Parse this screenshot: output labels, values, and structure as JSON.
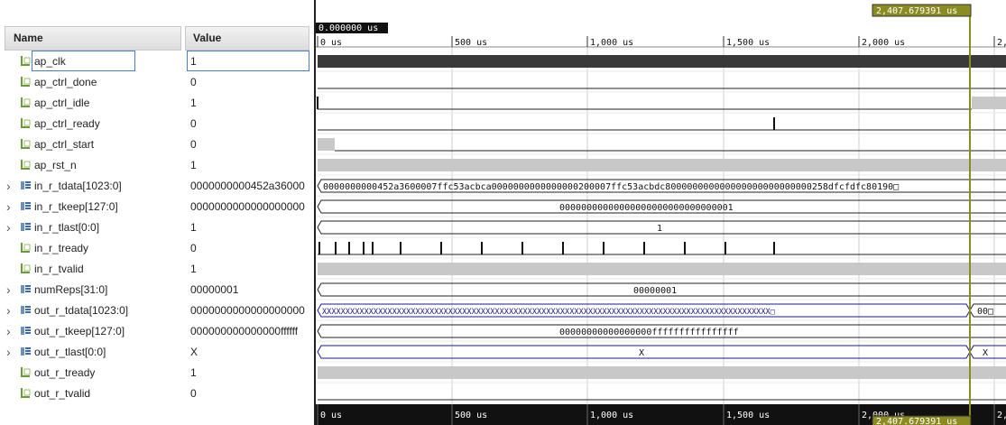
{
  "headers": {
    "name": "Name",
    "value": "Value"
  },
  "cursor": {
    "time_label": "2,407.679391 us",
    "origin_label": "0.000000 us"
  },
  "time_ruler": {
    "ticks": [
      "0 us",
      "500 us",
      "1,000 us",
      "1,500 us",
      "2,000 us",
      "2,"
    ]
  },
  "colors": {
    "wave_fill": "#c8c8c8",
    "bus_line": "#1a1a8c",
    "cursor": "#8b8b22",
    "cursor_label_bg": "#8b8b22"
  },
  "signals": [
    {
      "name": "ap_clk",
      "value": "1",
      "kind": "bit",
      "expandable": false
    },
    {
      "name": "ap_ctrl_done",
      "value": "0",
      "kind": "bit",
      "expandable": false
    },
    {
      "name": "ap_ctrl_idle",
      "value": "1",
      "kind": "bit",
      "expandable": false
    },
    {
      "name": "ap_ctrl_ready",
      "value": "0",
      "kind": "bit",
      "expandable": false
    },
    {
      "name": "ap_ctrl_start",
      "value": "0",
      "kind": "bit",
      "expandable": false
    },
    {
      "name": "ap_rst_n",
      "value": "1",
      "kind": "bit",
      "expandable": false
    },
    {
      "name": "in_r_tdata[1023:0]",
      "value": "0000000000452a36000",
      "kind": "bus",
      "expandable": true
    },
    {
      "name": "in_r_tkeep[127:0]",
      "value": "0000000000000000000",
      "kind": "bus",
      "expandable": true
    },
    {
      "name": "in_r_tlast[0:0]",
      "value": "1",
      "kind": "bus",
      "expandable": true
    },
    {
      "name": "in_r_tready",
      "value": "0",
      "kind": "bit",
      "expandable": false
    },
    {
      "name": "in_r_tvalid",
      "value": "1",
      "kind": "bit",
      "expandable": false
    },
    {
      "name": "numReps[31:0]",
      "value": "00000001",
      "kind": "bus",
      "expandable": true
    },
    {
      "name": "out_r_tdata[1023:0]",
      "value": "0000000000000000000",
      "kind": "bus",
      "expandable": true
    },
    {
      "name": "out_r_tkeep[127:0]",
      "value": "000000000000000ffffff",
      "kind": "bus",
      "expandable": true
    },
    {
      "name": "out_r_tlast[0:0]",
      "value": "X",
      "kind": "bus",
      "expandable": true
    },
    {
      "name": "out_r_tready",
      "value": "1",
      "kind": "bit",
      "expandable": false
    },
    {
      "name": "out_r_tvalid",
      "value": "0",
      "kind": "bit",
      "expandable": false
    }
  ],
  "bus_labels": {
    "in_r_tdata": "0000000000452a3600007ffc53acbca0000000000000000200007ffc53acbdc800000000000000000000000000258dfcfdfc80190□",
    "in_r_tkeep": "00000000000000000000000000000001",
    "in_r_tlast": "1",
    "numReps": "00000001",
    "out_r_tdata_a": "XXXXXXXXXXXXXXXXXXXXXXXXXXXXXXXXXXXXXXXXXXXXXXXXXXXXXXXXXXXXXXXXXXXXXXXXXXXXXXXXXXXXXXXXXXXXXXXX□",
    "out_r_tdata_b": "00□",
    "out_r_tkeep": "00000000000000000ffffffffffffffff",
    "out_r_tlast_a": "X",
    "out_r_tlast_b": "X"
  }
}
